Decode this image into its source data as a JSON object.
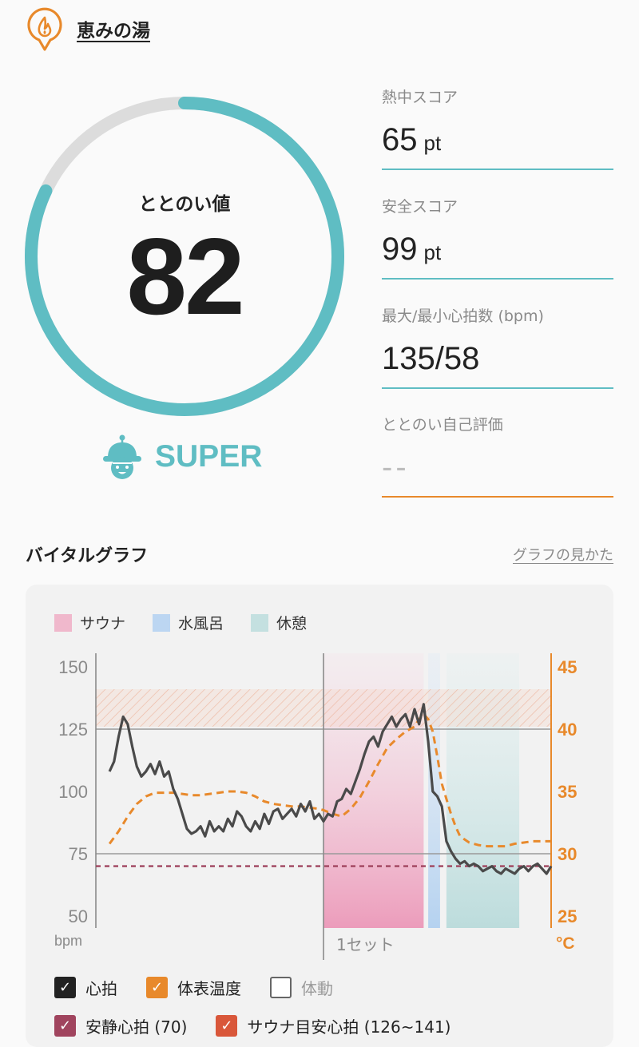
{
  "header": {
    "title": "恵みの湯",
    "icon": "sauna-pin-icon"
  },
  "score": {
    "label": "ととのい値",
    "value": "82",
    "progress": 0.82,
    "grade": "SUPER"
  },
  "stats": [
    {
      "label": "熱中スコア",
      "value": "65",
      "unit": "pt"
    },
    {
      "label": "安全スコア",
      "value": "99",
      "unit": "pt"
    },
    {
      "label": "最大/最小心拍数 (bpm)",
      "value": "135/58",
      "unit": ""
    },
    {
      "label": "ととのい自己評価",
      "value": "--",
      "unit": ""
    }
  ],
  "section": {
    "title": "バイタルグラフ",
    "help_link": "グラフの見かた"
  },
  "colors": {
    "teal": "#5fbdc3",
    "orange": "#e8892b",
    "sauna": "#f0b8cc",
    "cold_bath": "#bcd6f2",
    "rest": "#c4e0e0",
    "resting_hr": "#a0445e",
    "target_hr": "#d9573a"
  },
  "phase_legend": [
    {
      "label": "サウナ",
      "color": "#f0b8cc"
    },
    {
      "label": "水風呂",
      "color": "#bcd6f2"
    },
    {
      "label": "休憩",
      "color": "#c4e0e0"
    }
  ],
  "checkboxes": [
    [
      {
        "label": "心拍",
        "checked": true,
        "color": "#222222"
      },
      {
        "label": "体表温度",
        "checked": true,
        "color": "#e8892b"
      },
      {
        "label": "体動",
        "checked": false,
        "color": "#666666"
      }
    ],
    [
      {
        "label": "安静心拍 (70)",
        "checked": true,
        "color": "#a0445e"
      },
      {
        "label": "サウナ目安心拍 (126~141)",
        "checked": true,
        "color": "#d9573a"
      }
    ]
  ],
  "chart_data": {
    "type": "line",
    "y_left_label": "bpm",
    "y_right_label": "°C",
    "y_left_ticks": [
      150,
      125,
      100,
      75,
      50
    ],
    "y_right_ticks": [
      45,
      40,
      35,
      30,
      25
    ],
    "ylim_left": [
      50,
      150
    ],
    "ylim_right": [
      25,
      45
    ],
    "set_label": "1セット",
    "resting_hr": 70,
    "target_band": [
      126,
      141
    ],
    "phases": [
      {
        "name": "サウナ",
        "start": 0.5,
        "end": 0.72
      },
      {
        "name": "水風呂",
        "start": 0.73,
        "end": 0.756
      },
      {
        "name": "休憩",
        "start": 0.77,
        "end": 0.93
      }
    ],
    "series": [
      {
        "name": "心拍",
        "x": [
          0.03,
          0.04,
          0.05,
          0.06,
          0.07,
          0.08,
          0.09,
          0.1,
          0.11,
          0.12,
          0.13,
          0.14,
          0.15,
          0.16,
          0.17,
          0.18,
          0.19,
          0.2,
          0.21,
          0.22,
          0.23,
          0.24,
          0.25,
          0.26,
          0.27,
          0.28,
          0.29,
          0.3,
          0.31,
          0.32,
          0.33,
          0.34,
          0.35,
          0.36,
          0.37,
          0.38,
          0.39,
          0.4,
          0.41,
          0.42,
          0.43,
          0.44,
          0.45,
          0.46,
          0.47,
          0.48,
          0.49,
          0.5,
          0.51,
          0.52,
          0.53,
          0.54,
          0.55,
          0.56,
          0.57,
          0.58,
          0.59,
          0.6,
          0.61,
          0.62,
          0.63,
          0.64,
          0.65,
          0.66,
          0.67,
          0.68,
          0.69,
          0.7,
          0.71,
          0.72,
          0.73,
          0.74,
          0.75,
          0.76,
          0.77,
          0.78,
          0.79,
          0.8,
          0.81,
          0.82,
          0.83,
          0.84,
          0.85,
          0.86,
          0.87,
          0.88,
          0.89,
          0.9,
          0.91,
          0.92,
          0.93,
          0.94,
          0.95,
          0.96,
          0.97,
          0.98,
          0.99,
          1.0
        ],
        "values": [
          108,
          112,
          122,
          130,
          127,
          118,
          110,
          106,
          108,
          111,
          107,
          112,
          106,
          108,
          101,
          97,
          91,
          85,
          83,
          84,
          86,
          82,
          88,
          84,
          86,
          84,
          89,
          86,
          92,
          90,
          86,
          84,
          88,
          85,
          91,
          87,
          92,
          93,
          89,
          91,
          93,
          90,
          95,
          92,
          96,
          89,
          91,
          88,
          91,
          90,
          96,
          97,
          101,
          99,
          104,
          109,
          115,
          120,
          122,
          118,
          124,
          127,
          130,
          126,
          129,
          131,
          126,
          133,
          127,
          135,
          120,
          100,
          98,
          94,
          80,
          76,
          73,
          71,
          72,
          70,
          71,
          70,
          68,
          69,
          70,
          68,
          67,
          69,
          68,
          67,
          69,
          70,
          68,
          70,
          71,
          69,
          67,
          70
        ]
      },
      {
        "name": "体表温度",
        "x": [
          0.03,
          0.05,
          0.07,
          0.09,
          0.11,
          0.13,
          0.15,
          0.17,
          0.19,
          0.21,
          0.23,
          0.25,
          0.27,
          0.29,
          0.31,
          0.33,
          0.35,
          0.37,
          0.39,
          0.41,
          0.43,
          0.45,
          0.47,
          0.49,
          0.5,
          0.52,
          0.54,
          0.56,
          0.58,
          0.6,
          0.62,
          0.64,
          0.66,
          0.68,
          0.7,
          0.71,
          0.72,
          0.73,
          0.74,
          0.75,
          0.76,
          0.77,
          0.78,
          0.79,
          0.8,
          0.82,
          0.84,
          0.86,
          0.88,
          0.9,
          0.92,
          0.94,
          0.96,
          0.98,
          1.0
        ],
        "values": [
          30.8,
          31.8,
          33.0,
          34.0,
          34.6,
          34.9,
          34.9,
          34.9,
          34.8,
          34.7,
          34.7,
          34.8,
          34.9,
          35.0,
          35.0,
          34.9,
          34.6,
          34.2,
          34.0,
          33.9,
          33.8,
          33.8,
          33.7,
          33.6,
          33.5,
          33.2,
          33.0,
          33.6,
          34.5,
          35.8,
          37.2,
          38.5,
          39.2,
          39.8,
          40.2,
          40.8,
          41.2,
          40.8,
          39.8,
          37.8,
          35.6,
          34.4,
          33.2,
          32.2,
          31.4,
          30.9,
          30.7,
          30.6,
          30.6,
          30.6,
          30.8,
          30.9,
          31.0,
          31.0,
          31.0
        ]
      }
    ]
  }
}
